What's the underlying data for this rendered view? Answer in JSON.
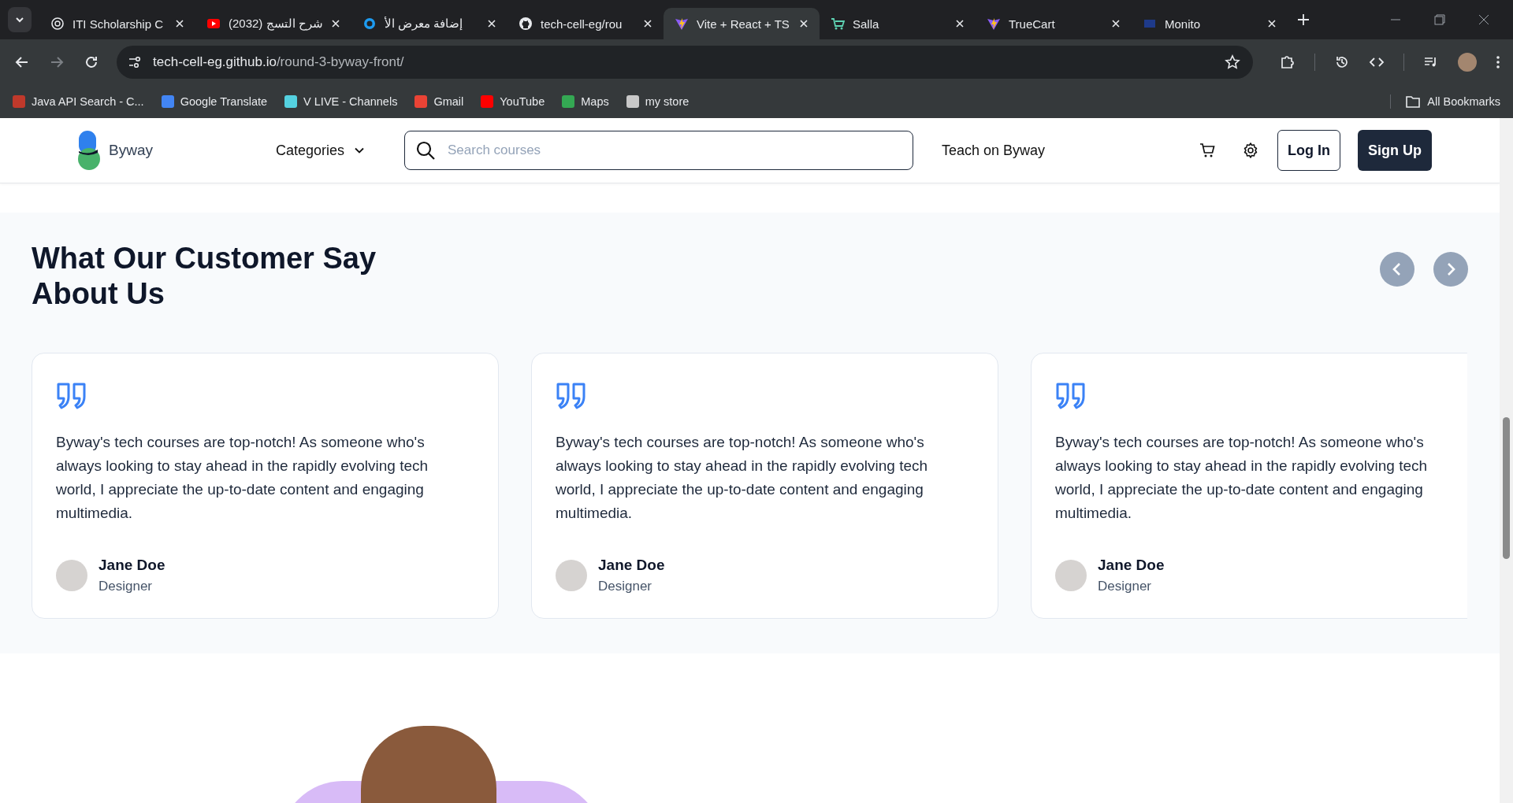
{
  "browser": {
    "tabs": [
      {
        "title": "ITI Scholarship C",
        "selected": false,
        "kind": "openai"
      },
      {
        "title": "(2032) شرح التسج",
        "selected": false,
        "kind": "youtube"
      },
      {
        "title": "إضافة معرض الأ",
        "selected": false,
        "kind": "ring"
      },
      {
        "title": "tech-cell-eg/rou",
        "selected": false,
        "kind": "github"
      },
      {
        "title": "Vite + React + TS",
        "selected": true,
        "kind": "vite"
      },
      {
        "title": "Salla",
        "selected": false,
        "kind": "cart"
      },
      {
        "title": "TrueCart",
        "selected": false,
        "kind": "vite"
      },
      {
        "title": "Monito",
        "selected": false,
        "kind": "mono"
      }
    ],
    "url_host": "tech-cell-eg.github.io",
    "url_path": "/round-3-byway-front/",
    "bookmarks": [
      {
        "label": "Java API Search - C...",
        "color": "#c0392b"
      },
      {
        "label": "Google Translate",
        "color": "#4285f4"
      },
      {
        "label": "V LIVE - Channels",
        "color": "#54d1e0"
      },
      {
        "label": "Gmail",
        "color": "#ea4335"
      },
      {
        "label": "YouTube",
        "color": "#ff0000"
      },
      {
        "label": "Maps",
        "color": "#34a853"
      },
      {
        "label": "my store",
        "color": "#c8c8c8"
      }
    ],
    "all_bookmarks": "All Bookmarks"
  },
  "header": {
    "brand": "Byway",
    "categories": "Categories",
    "search_placeholder": "Search courses",
    "teach": "Teach on Byway",
    "login": "Log In",
    "signup": "Sign Up"
  },
  "testimonials": {
    "title_lines": [
      "What Our Customer Say",
      "About Us"
    ],
    "cards": [
      {
        "quote": "Byway's tech courses are top-notch! As someone who's always looking to stay ahead in the rapidly evolving tech world, I appreciate the up-to-date content and engaging multimedia.",
        "name": "Jane Doe",
        "role": "Designer"
      },
      {
        "quote": "Byway's tech courses are top-notch! As someone who's always looking to stay ahead in the rapidly evolving tech world, I appreciate the up-to-date content and engaging multimedia.",
        "name": "Jane Doe",
        "role": "Designer"
      },
      {
        "quote": "Byway's tech courses are top-notch! As someone who's always looking to stay ahead in the rapidly evolving tech world, I appreciate the up-to-date content and engaging multimedia.",
        "name": "Jane Doe",
        "role": "Designer"
      }
    ]
  }
}
